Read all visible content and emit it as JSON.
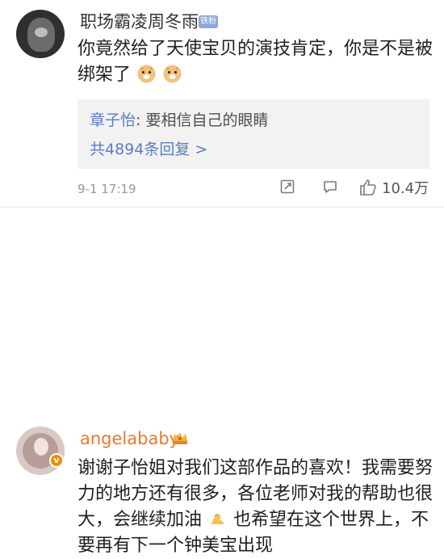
{
  "comments": [
    {
      "username": "职场霸凌周冬雨",
      "badge": "铁粉",
      "text": "你竟然给了天使宝贝的演技肯定，你是不是被绑架了",
      "emojis": [
        "doge",
        "doge"
      ],
      "reply": {
        "name": "章子怡",
        "text": ": 要相信自己的眼睛",
        "more": "共4894条回复 >"
      },
      "time": "9-1 17:19",
      "likes": "10.4万"
    },
    {
      "username": "angelababy",
      "badge_icon": "crown-icon",
      "text_before": "谢谢子怡姐对我们这部作品的喜欢！我需要努力的地方还有很多，各位老师对我的帮助也很大，会继续加油",
      "text_after": "也希望在这个世界上，不要再有下一个钟美宝出现",
      "emoji": "flexed-biceps-icon",
      "verified": "v"
    }
  ],
  "colors": {
    "username": "#333333",
    "vip_name": "#e8792f",
    "link_blue": "#587ec2",
    "meta_gray": "#999999"
  }
}
